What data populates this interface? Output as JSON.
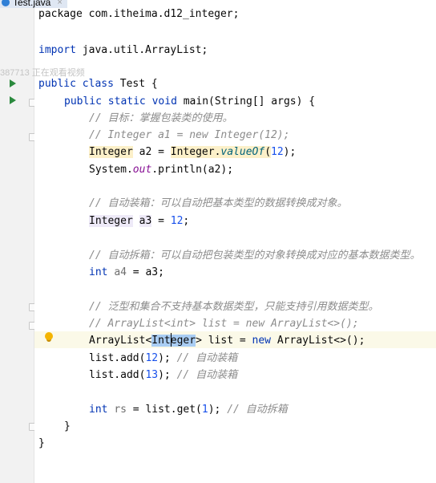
{
  "tab": {
    "title": "Test.java",
    "close": "×"
  },
  "overlay_text": "387713 正在观看视频",
  "code": {
    "l0": {
      "a": "package com.itheima.d12_integer;"
    },
    "l1": {
      "kw": "import",
      "b": " java.util.ArrayList;"
    },
    "l2": {
      "kw1": "public",
      "sp": " ",
      "kw2": "class",
      "b": " Test {"
    },
    "l3": {
      "kw1": "public",
      "kw2": "static",
      "kw3": "void",
      "b": " main(String[] args) {"
    },
    "l4": {
      "cm": "// 目标：掌握包装类的使用。"
    },
    "l5": {
      "cm": "// Integer a1 = new Integer(12);"
    },
    "l6": {
      "t1": "Integer",
      "a": " a2 = ",
      "t2": "Integer",
      "dot": ".",
      "m": "valueOf",
      "p1": "(",
      "n": "12",
      "p2": ");"
    },
    "l7": {
      "a": "System.",
      "st": "out",
      "b": ".println(a2);"
    },
    "l8": {
      "cm": "// 自动装箱：可以自动把基本类型的数据转换成对象。"
    },
    "l9": {
      "t": "Integer",
      "sp": " ",
      "v": "a3",
      "a": " = ",
      "n": "12",
      "b": ";"
    },
    "l10": {
      "cm": "// 自动拆箱：可以自动把包装类型的对象转换成对应的基本数据类型。"
    },
    "l11": {
      "kw": "int",
      "sp": " ",
      "v": "a4",
      "a": " = a3;"
    },
    "l12": {
      "cm": "// 泛型和集合不支持基本数据类型，只能支持引用数据类型。"
    },
    "l13": {
      "cm": "// ArrayList<int> list = new ArrayList<>();"
    },
    "l14": {
      "a": "ArrayList<",
      "hl": "Integer",
      "b": "> list = ",
      "kw": "new",
      "c": " ArrayList<>();"
    },
    "l15": {
      "a": "list.add(",
      "n": "12",
      "b": "); ",
      "cm": "// 自动装箱"
    },
    "l16": {
      "a": "list.add(",
      "n": "13",
      "b": "); ",
      "cm": "// 自动装箱"
    },
    "l17": {
      "kw": "int",
      "sp": " ",
      "v": "rs",
      "a": " = list.get(",
      "n": "1",
      "b": "); ",
      "cm": "// 自动拆箱"
    },
    "l18": {
      "a": "}"
    },
    "l19": {
      "a": "}"
    }
  },
  "colors": {
    "keyword": "#0033b3",
    "comment": "#8c8c8c",
    "number": "#1750eb",
    "static_field": "#871094",
    "method": "#00627a"
  }
}
